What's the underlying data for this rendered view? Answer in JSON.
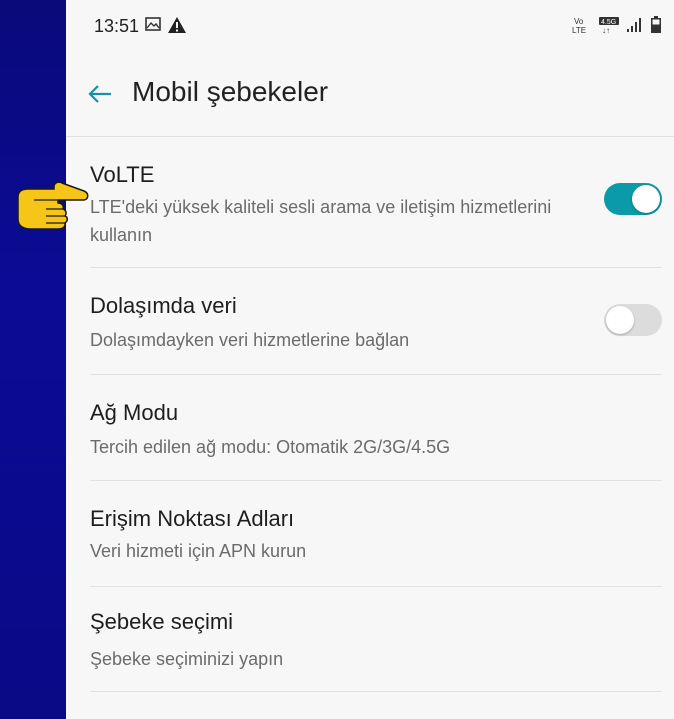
{
  "status_bar": {
    "time": "13:51",
    "icons": [
      "image-icon",
      "warning-icon",
      "volte-icon",
      "4.5g-icon",
      "signal-icon",
      "battery-icon"
    ],
    "volte_label": "Vo LTE",
    "network_label": "4.5G"
  },
  "header": {
    "title": "Mobil şebekeler",
    "back_icon": "back-arrow-icon"
  },
  "items": [
    {
      "title": "VoLTE",
      "subtitle": "LTE'deki yüksek kaliteli sesli arama ve iletişim hizmetlerini kullanın",
      "toggle": true
    },
    {
      "title": "Dolaşımda veri",
      "subtitle": "Dolaşımdayken veri hizmetlerine bağlan",
      "toggle": false
    },
    {
      "title": "Ağ Modu",
      "subtitle": "Tercih edilen ağ modu: Otomatik 2G/3G/4.5G"
    },
    {
      "title": "Erişim Noktası Adları",
      "subtitle": "Veri hizmeti için APN kurun"
    },
    {
      "title": "Şebeke seçimi",
      "subtitle": "Şebeke seçiminizi yapın"
    }
  ],
  "colors": {
    "accent": "#0b9aa8",
    "pointer": "#f5c518",
    "left_panel": "#0a0a86"
  },
  "overlay": {
    "pointer_icon": "pointing-hand-icon"
  }
}
